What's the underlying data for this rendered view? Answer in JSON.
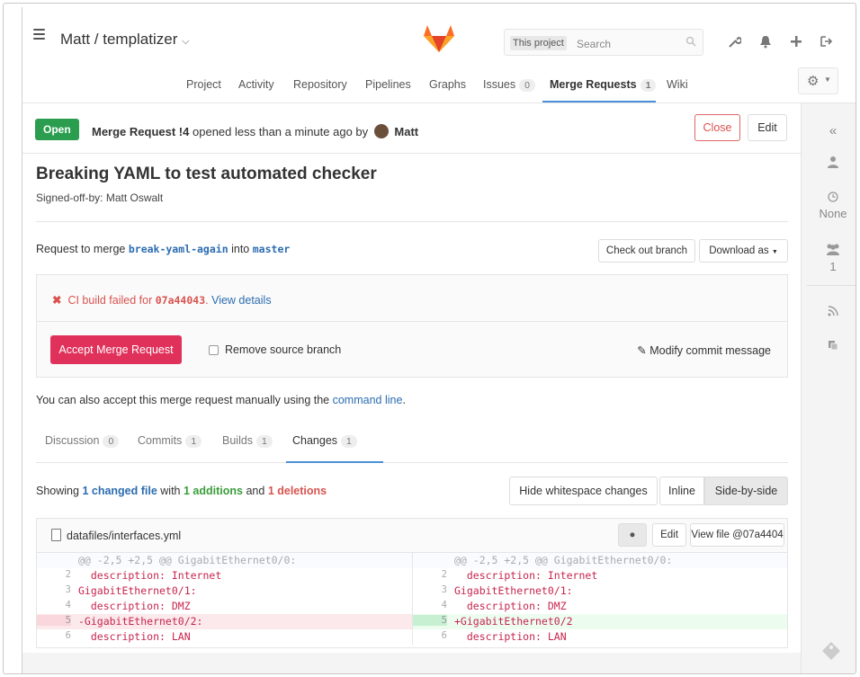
{
  "header": {
    "project_title": "Matt / templatizer",
    "search_scope": "This project",
    "search_placeholder": "Search"
  },
  "nav": {
    "items": [
      {
        "label": "Project"
      },
      {
        "label": "Activity"
      },
      {
        "label": "Repository"
      },
      {
        "label": "Pipelines"
      },
      {
        "label": "Graphs"
      },
      {
        "label": "Issues",
        "count": "0"
      },
      {
        "label": "Merge Requests",
        "count": "1",
        "active": true
      },
      {
        "label": "Wiki"
      }
    ]
  },
  "mr": {
    "status": "Open",
    "ref": "Merge Request !4",
    "opened_text": "opened less than a minute ago by",
    "author": "Matt",
    "close_label": "Close",
    "edit_label": "Edit",
    "title": "Breaking YAML to test automated checker",
    "signed_off": "Signed-off-by: Matt Oswalt",
    "request_prefix": "Request to merge",
    "source_branch": "break-yaml-again",
    "into": "into",
    "target_branch": "master",
    "checkout_label": "Check out branch",
    "download_label": "Download as"
  },
  "ci": {
    "fail_prefix": "CI build failed for",
    "sha": "07a44043",
    "period": ".",
    "view_details": "View details",
    "accept_label": "Accept Merge Request",
    "remove_source_label": "Remove source branch",
    "modify_commit_label": "Modify commit message"
  },
  "manual": {
    "text": "You can also accept this merge request manually using the",
    "link": "command line",
    "period": "."
  },
  "tabs": [
    {
      "label": "Discussion",
      "count": "0"
    },
    {
      "label": "Commits",
      "count": "1"
    },
    {
      "label": "Builds",
      "count": "1"
    },
    {
      "label": "Changes",
      "count": "1",
      "active": true
    }
  ],
  "changes": {
    "showing": "Showing",
    "files_link": "1 changed file",
    "with": "with",
    "additions": "1 additions",
    "and": "and",
    "deletions": "1 deletions",
    "hide_whitespace": "Hide whitespace changes",
    "inline": "Inline",
    "side_by_side": "Side-by-side"
  },
  "diff": {
    "file_name": "datafiles/interfaces.yml",
    "edit_label": "Edit",
    "view_file_label": "View file @07a4404",
    "hunk": "@@ -2,5 +2,5 @@ GigabitEthernet0/0:",
    "rows": [
      {
        "left_ln": "2",
        "left": "  description: Internet",
        "right_ln": "2",
        "right": "  description: Internet",
        "type": "ctx"
      },
      {
        "left_ln": "3",
        "left": "GigabitEthernet0/1:",
        "right_ln": "3",
        "right": "GigabitEthernet0/1:",
        "type": "ctx"
      },
      {
        "left_ln": "4",
        "left": "  description: DMZ",
        "right_ln": "4",
        "right": "  description: DMZ",
        "type": "ctx"
      },
      {
        "left_ln": "5",
        "left": "-GigabitEthernet0/2:",
        "right_ln": "5",
        "right": "+GigabitEthernet0/2",
        "type": "change"
      },
      {
        "left_ln": "6",
        "left": "  description: LAN",
        "right_ln": "6",
        "right": "  description: LAN",
        "type": "ctx"
      }
    ]
  },
  "sidebar": {
    "collapse_icon": "double-chevron-left-icon",
    "milestone_value": "None",
    "participants_value": "1"
  },
  "colors": {
    "accent": "#4a90d9",
    "open_badge": "#2a9d4f",
    "accept_button": "#e0315b",
    "danger": "#d9534f",
    "fox_orange": "#fc6d26"
  }
}
